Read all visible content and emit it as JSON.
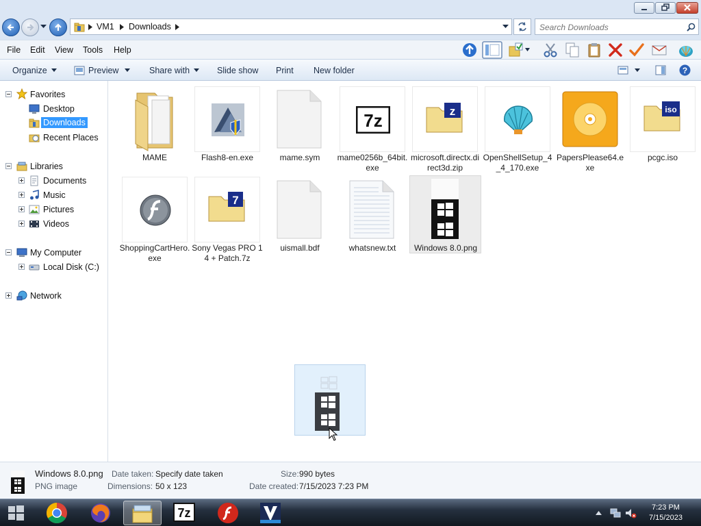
{
  "address": {
    "segments": [
      "VM1",
      "Downloads"
    ]
  },
  "search": {
    "placeholder": "Search Downloads"
  },
  "menu": {
    "file": "File",
    "edit": "Edit",
    "view": "View",
    "tools": "Tools",
    "help": "Help"
  },
  "command_bar": {
    "organize": "Organize",
    "preview": "Preview",
    "share_with": "Share with",
    "slide_show": "Slide show",
    "print": "Print",
    "new_folder": "New folder"
  },
  "nav": {
    "favorites": "Favorites",
    "desktop": "Desktop",
    "downloads": "Downloads",
    "recent_places": "Recent Places",
    "libraries": "Libraries",
    "documents": "Documents",
    "music": "Music",
    "pictures": "Pictures",
    "videos": "Videos",
    "my_computer": "My Computer",
    "local_disk": "Local Disk (C:)",
    "network": "Network"
  },
  "files": [
    {
      "name": "MAME",
      "icon": "folder-icon"
    },
    {
      "name": "Flash8-en.exe",
      "icon": "installer-icon"
    },
    {
      "name": "mame.sym",
      "icon": "blank-file-icon"
    },
    {
      "name": "mame0256b_64bit.exe",
      "icon": "7z-icon"
    },
    {
      "name": "microsoft.directx.direct3d.zip",
      "icon": "zip-folder-icon"
    },
    {
      "name": "OpenShellSetup_4_4_170.exe",
      "icon": "shell-icon"
    },
    {
      "name": "PapersPlease64.exe",
      "icon": "disc-app-icon"
    },
    {
      "name": "pcgc.iso",
      "icon": "iso-folder-icon"
    },
    {
      "name": "ShoppingCartHero.exe",
      "icon": "flash-icon"
    },
    {
      "name": "Sony Vegas PRO 14 + Patch.7z",
      "icon": "7z-archive-icon"
    },
    {
      "name": "uismall.bdf",
      "icon": "blank-file-icon"
    },
    {
      "name": "whatsnew.txt",
      "icon": "text-file-icon"
    },
    {
      "name": "Windows 8.0.png",
      "icon": "windows-logo-image"
    }
  ],
  "details": {
    "filename": "Windows 8.0.png",
    "filetype": "PNG image",
    "date_taken_label": "Date taken:",
    "date_taken_value": "Specify date taken",
    "dimensions_label": "Dimensions:",
    "dimensions_value": "50 x 123",
    "size_label": "Size:",
    "size_value": "990 bytes",
    "date_created_label": "Date created:",
    "date_created_value": "7/15/2023 7:23 PM"
  },
  "taskbar": {
    "apps": [
      "start-orb",
      "chrome-icon",
      "firefox-icon",
      "explorer-icon",
      "7zip-icon",
      "flash-icon",
      "vegas-icon"
    ],
    "clock_time": "7:23 PM",
    "clock_date": "7/15/2023"
  },
  "colors": {
    "selection": "#3399ff",
    "frame": "#dbe6f4",
    "taskbar": "#25303f"
  }
}
